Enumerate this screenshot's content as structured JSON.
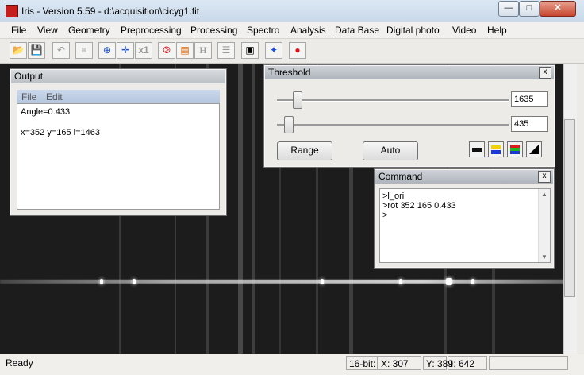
{
  "window": {
    "title": "Iris - Version 5.59 - d:\\acquisition\\cicyg1.fit",
    "min_glyph": "—",
    "max_glyph": "□",
    "close_glyph": "✕"
  },
  "menu": {
    "file": "File",
    "view": "View",
    "geometry": "Geometry",
    "preprocessing": "Preprocessing",
    "processing": "Processing",
    "spectro": "Spectro",
    "analysis": "Analysis",
    "database": "Data Base",
    "digital_photo": "Digital photo",
    "video": "Video",
    "help": "Help"
  },
  "toolbar": {
    "open_glyph": "📂",
    "save_glyph": "💾",
    "undo_glyph": "↶",
    "adjust_glyph": "≡",
    "zoom_glyph": "⊕",
    "pan_glyph": "✛",
    "x1_label": "x1",
    "spiral_glyph": "⧁",
    "stack_glyph": "▤",
    "header_label": "H",
    "list_glyph": "☰",
    "camera_glyph": "▣",
    "star_glyph": "✦",
    "record_glyph": "●"
  },
  "output": {
    "title": "Output",
    "menu_file": "File",
    "menu_edit": "Edit",
    "line1": "Angle=0.433",
    "line2": "x=352  y=165  i=1463"
  },
  "threshold": {
    "title": "Threshold",
    "high_value": "1635",
    "low_value": "435",
    "high_fraction": 0.07,
    "low_fraction": 0.03,
    "range_label": "Range",
    "auto_label": "Auto",
    "close_glyph": "x"
  },
  "command": {
    "title": "Command",
    "close_glyph": "x",
    "lines": [
      ">l_ori",
      ">rot 352 165 0.433",
      ">"
    ],
    "up_glyph": "▲",
    "down_glyph": "▼"
  },
  "statusbar": {
    "status": "Ready",
    "bitdepth": "16-bit:",
    "x": "X: 307",
    "y": "Y: 389",
    "i": "I: 642"
  },
  "colors": {
    "title_gradient": "#c9d9ea",
    "workspace_bg": "#1c1c1c",
    "record_red": "#e0101a",
    "star_blue": "#1a4fd8"
  }
}
